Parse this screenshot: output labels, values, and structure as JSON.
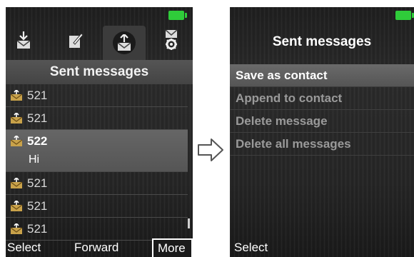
{
  "left_screen": {
    "title": "Sent messages",
    "tabs": [
      {
        "icon": "inbox-download-icon",
        "active": false
      },
      {
        "icon": "compose-note-icon",
        "active": false
      },
      {
        "icon": "sent-upload-icon",
        "active": true
      },
      {
        "icon": "message-settings-icon",
        "active": false
      }
    ],
    "messages": [
      {
        "number": "521"
      },
      {
        "number": "521"
      },
      {
        "number": "522",
        "preview": "Hi",
        "expanded": true
      },
      {
        "number": "521"
      },
      {
        "number": "521"
      },
      {
        "number": "521"
      }
    ],
    "softkeys": {
      "left": "Select",
      "center": "Forward",
      "right": "More"
    }
  },
  "right_screen": {
    "title": "Sent messages",
    "menu": [
      {
        "label": "Save as contact",
        "selected": true
      },
      {
        "label": "Append to contact"
      },
      {
        "label": "Delete message"
      },
      {
        "label": "Delete all messages"
      }
    ],
    "softkeys": {
      "left": "Select"
    }
  },
  "colors": {
    "battery": "#2fcc3a",
    "background": "#262626",
    "highlight": "#606060"
  }
}
